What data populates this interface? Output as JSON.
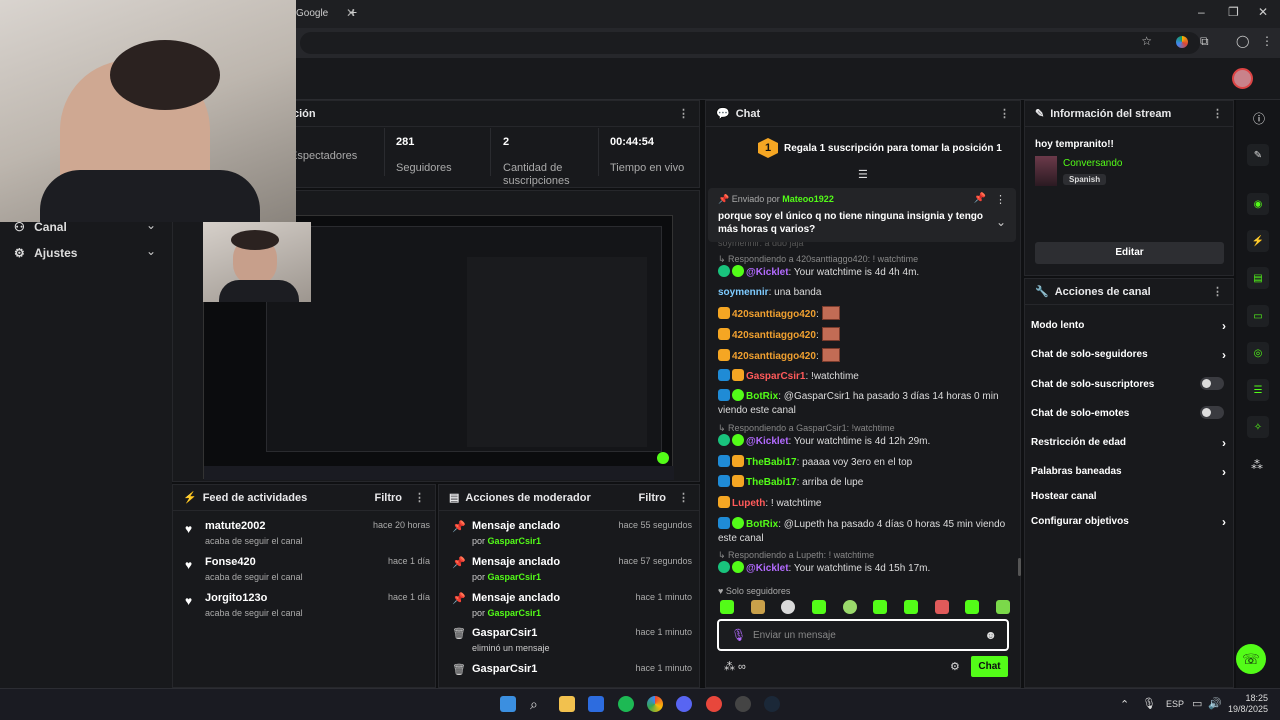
{
  "browser": {
    "tab_title": "Google",
    "new_tab": "+"
  },
  "stats": [
    {
      "value": "",
      "label": "Espectadores"
    },
    {
      "value": "281",
      "label": "Seguidores"
    },
    {
      "value": "2",
      "label": "Cantidad de suscripciones"
    },
    {
      "value": "00:44:54",
      "label": "Tiempo en vivo"
    }
  ],
  "panel_top_left_title": "ción",
  "sidebar": {
    "canal": "Canal",
    "ajustes": "Ajustes"
  },
  "feed": {
    "title": "Feed de actividades",
    "filter": "Filtro",
    "items": [
      {
        "name": "matute2002",
        "sub": "acaba de seguir el canal",
        "time": "hace 20 horas"
      },
      {
        "name": "Fonse420",
        "sub": "acaba de seguir el canal",
        "time": "hace 1 día"
      },
      {
        "name": "Jorgito123o",
        "sub": "acaba de seguir el canal",
        "time": "hace 1 día"
      }
    ]
  },
  "mod": {
    "title": "Acciones de moderador",
    "filter": "Filtro",
    "items": [
      {
        "title": "Mensaje anclado",
        "by": "por",
        "user": "GasparCsir1",
        "time": "hace 55 segundos"
      },
      {
        "title": "Mensaje anclado",
        "by": "por",
        "user": "GasparCsir1",
        "time": "hace 57 segundos"
      },
      {
        "title": "Mensaje anclado",
        "by": "por",
        "user": "GasparCsir1",
        "time": "hace 1 minuto"
      },
      {
        "title": "GasparCsir1",
        "by": "eliminó un mensaje",
        "user": "",
        "time": "hace 1 minuto"
      },
      {
        "title": "GasparCsir1",
        "by": "",
        "user": "",
        "time": "hace 1 minuto"
      }
    ]
  },
  "chat": {
    "title": "Chat",
    "sub_banner": "Regala 1 suscripción para tomar la posición 1",
    "sub_banner_rank": "1",
    "pinned_by_label": "Enviado por",
    "pinned_by_user": "Mateoo1922",
    "pinned_text": "porque soy el único q no tiene ninguna insignia y tengo más horas q varios?",
    "partial_top": "soymennir: a duo jaja",
    "reply1": "Respondiendo a 420santtiaggo420: ! watchtime",
    "msg1_user": "@Kicklet",
    "msg1_text": ": Your watchtime is 4d 4h 4m.",
    "msg2_user": "soymennir",
    "msg2_text": ": una banda",
    "msg3_user": "420santtiaggo420",
    "msg6_user": "GasparCsir1",
    "msg6_text": ": !watchtime",
    "msg7_user": "BotRix",
    "msg7_text": ": @GasparCsir1 ha pasado 3 días 14 horas 0 min viendo este canal",
    "reply2": "Respondiendo a GasparCsir1: !watchtime",
    "msg8_user": "@Kicklet",
    "msg8_text": ": Your watchtime is 4d 12h 29m.",
    "msg9_user": "TheBabi17",
    "msg9_text": ": paaaa voy 3ero en el top",
    "msg10_user": "TheBabi17",
    "msg10_text": ": arriba de lupe",
    "msg11_user": "Lupeth",
    "msg11_text": ": ! watchtime",
    "msg12_user": "BotRix",
    "msg12_text": ": @Lupeth ha pasado 4 días 0 horas 45 min viendo este canal",
    "reply3": "Respondiendo a Lupeth: ! watchtime",
    "msg13_user": "@Kicklet",
    "msg13_text": ": Your watchtime is 4d 15h 17m.",
    "followers_only": "Solo seguidores",
    "input_placeholder": "Enviar un mensaje",
    "send_label": "Chat"
  },
  "stream_info": {
    "title": "Información del stream",
    "stream_title": "hoy tempranito!!",
    "category": "Conversando",
    "language": "Spanish",
    "edit": "Editar"
  },
  "channel_actions": {
    "title": "Acciones de canal",
    "items": [
      {
        "label": "Modo lento",
        "control": "chevron"
      },
      {
        "label": "Chat de solo-seguidores",
        "control": "chevron"
      },
      {
        "label": "Chat de solo-suscriptores",
        "control": "toggle"
      },
      {
        "label": "Chat de solo-emotes",
        "control": "toggle"
      },
      {
        "label": "Restricción de edad",
        "control": "chevron"
      },
      {
        "label": "Palabras baneadas",
        "control": "chevron"
      },
      {
        "label": "Hostear canal",
        "control": "none"
      },
      {
        "label": "Configurar objetivos",
        "control": "chevron"
      }
    ]
  },
  "taskbar": {
    "lang": "ESP",
    "time": "18:25",
    "date": "19/8/2025"
  },
  "colors": {
    "accent": "#53fc18",
    "panel": "#18191c",
    "background": "#0f1012"
  }
}
